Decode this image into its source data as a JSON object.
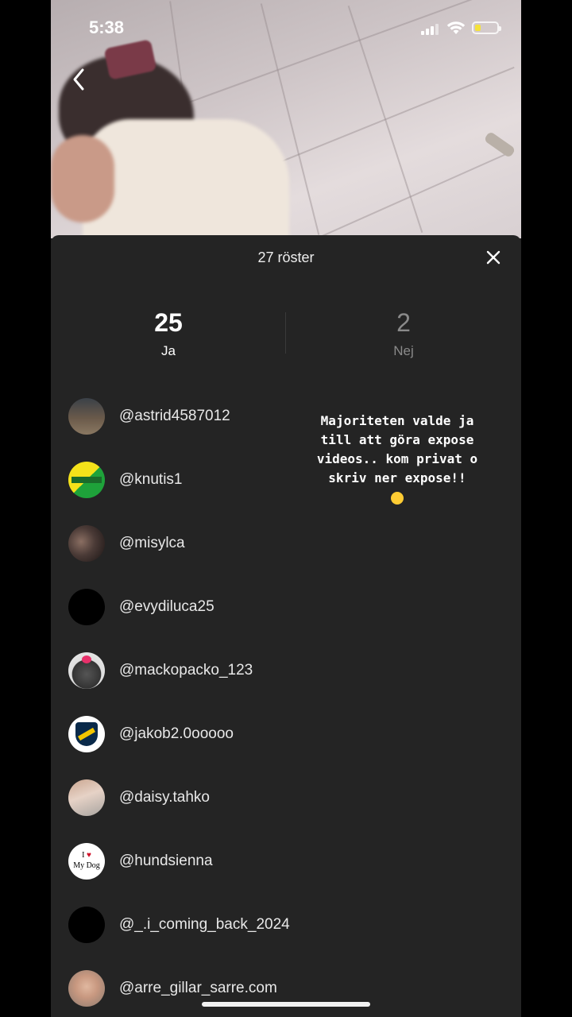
{
  "status_bar": {
    "time": "5:38",
    "battery_level": 0.25
  },
  "sheet": {
    "title": "27 röster",
    "yes": {
      "count": "25",
      "label": "Ja"
    },
    "no": {
      "count": "2",
      "label": "Nej"
    }
  },
  "overlay_text": "Majoriteten valde ja till att göra expose videos.. kom privat o skriv ner expose!!",
  "voters": [
    {
      "username": "@astrid4587012",
      "avatar": "photo-avatar"
    },
    {
      "username": "@knutis1",
      "avatar": "green-yellow-logo-avatar"
    },
    {
      "username": "@misylca",
      "avatar": "photo-avatar"
    },
    {
      "username": "@evydiluca25",
      "avatar": "blank-avatar"
    },
    {
      "username": "@mackopacko_123",
      "avatar": "troll-avatar"
    },
    {
      "username": "@jakob2.0ooooo",
      "avatar": "club-crest-avatar"
    },
    {
      "username": "@daisy.tahko",
      "avatar": "photo-avatar"
    },
    {
      "username": "@hundsienna",
      "avatar": "i-love-my-dog-avatar",
      "avatar_text": "I ♥ My Dog"
    },
    {
      "username": "@_.i_coming_back_2024",
      "avatar": "blank-avatar"
    },
    {
      "username": "@arre_gillar_sarre.com",
      "avatar": "photo-avatar"
    }
  ],
  "colors": {
    "sheet_bg": "#242424",
    "battery": "#f5e23a"
  }
}
